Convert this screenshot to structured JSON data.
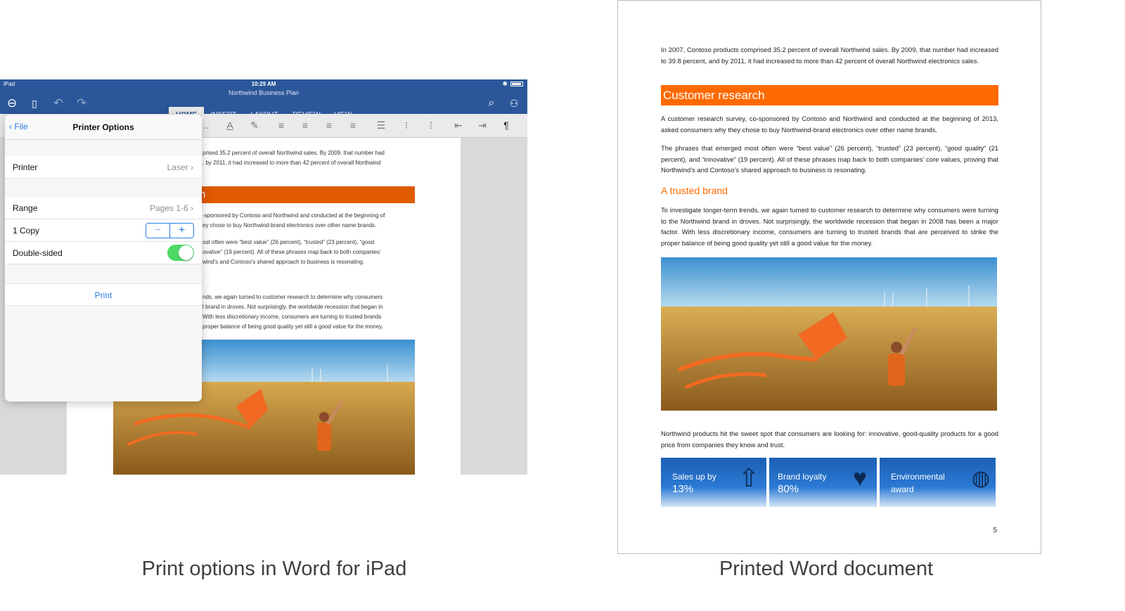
{
  "ipad": {
    "status": {
      "device": "iPad",
      "time": "10:29 AM"
    },
    "doc_title": "Northwind Business Plan",
    "tabs": [
      "HOME",
      "INSERT",
      "LAYOUT",
      "REVIEW",
      "VIEW"
    ],
    "page_text": {
      "p1": "prised 35.2 percent of overall Northwind sales. By 2009, that number had",
      "p1b": ", by 2011, it had increased to more than 42 percent of overall Northwind",
      "heading_fragment": "h",
      "p2a": "-sponsored by Contoso and Northwind and conducted at the beginning of",
      "p2b": "ey chose to buy Northwind-brand electronics over other name brands.",
      "p3a": "ost often were “best value” (26 percent), “trusted” (23 percent), “good",
      "p3b": "ovative” (19 percent). All of these phrases map back to both companies’",
      "p3c": "wind’s and Contoso’s shared approach to business is resonating.",
      "p4a": "nds, we again turned to customer research to determine why consumers",
      "p4b": "l brand in droves. Not surprisingly, the worldwide recession that began in",
      "p4c": "With less discretionary income, consumers are turning to trusted brands",
      "p4d": "proper balance of being good quality yet still a good value for the money."
    },
    "popover": {
      "back_label": "File",
      "title": "Printer Options",
      "printer_label": "Printer",
      "printer_value": "Laser",
      "range_label": "Range",
      "range_value": "Pages 1-6",
      "copies_label": "1 Copy",
      "double_sided_label": "Double-sided",
      "double_sided_on": true,
      "print_label": "Print"
    }
  },
  "printed": {
    "p1": "In 2007, Contoso products comprised 35.2 percent of overall Northwind sales. By 2009, that number had increased to 39.8 percent, and by 2011, it had increased to more than 42 percent of overall Northwind electronics sales.",
    "heading1": "Customer research",
    "p2": "A customer research survey, co-sponsored by Contoso and Northwind and conducted at the beginning of 2013, asked consumers why they chose to buy Northwind-brand electronics over other name brands.",
    "p3": "The phrases that emerged most often were “best value” (26 percent), “trusted” (23 percent), “good quality” (21 percent), and “innovative” (19 percent). All of these phrases map back to both companies’ core values, proving that Northwind’s and Contoso’s shared approach to business is resonating.",
    "heading2": "A trusted brand",
    "p4": "To investigate longer-term trends, we again turned to customer research to determine why consumers were turning to the Northwind brand in droves. Not surprisingly, the worldwide recession that began in 2008 has been a major factor. With less discretionary income, consumers are turning to trusted brands that are perceived to strike the proper balance of being good quality yet still a good value for the money.",
    "p5": "Northwind products hit the sweet spot that consumers are looking for: innovative, good-quality products for a good price from companies they know and trust.",
    "tiles": [
      {
        "line1": "Sales up by",
        "line2": "13%"
      },
      {
        "line1": "Brand loyalty",
        "line2": "80%"
      },
      {
        "line1": "Environmental",
        "line2": "award"
      }
    ],
    "page_number": "5"
  },
  "captions": {
    "left": "Print options in Word for iPad",
    "right": "Printed Word document"
  },
  "colors": {
    "word_blue": "#2b579a",
    "accent_orange": "#ff6a00",
    "ios_blue": "#2b7be4",
    "ios_green": "#4cd964"
  }
}
